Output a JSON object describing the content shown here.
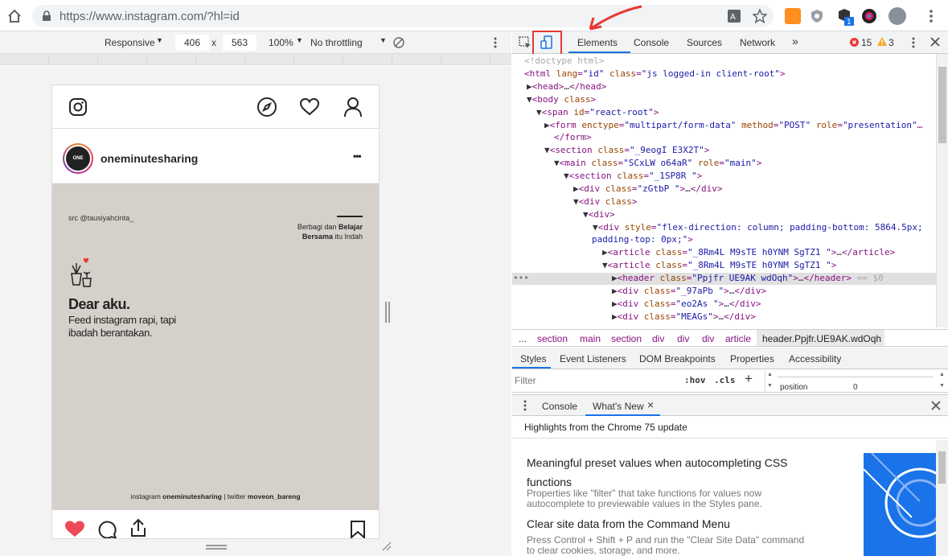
{
  "browser": {
    "url": "https://www.instagram.com/?hl=id"
  },
  "device_toolbar": {
    "mode": "Responsive",
    "width": "406",
    "times": "x",
    "height": "563",
    "zoom": "100%",
    "throttle": "No throttling"
  },
  "instagram": {
    "username": "oneminutesharing",
    "more": "•••",
    "avatar_text": "ONE",
    "post": {
      "src": "src @tausiyahcinta_",
      "tagline_line1": "Berbagi dan",
      "tagline_bold1": "Belajar",
      "tagline_bold2": "Bersama",
      "tagline_line2": "itu Indah",
      "title": "Dear aku.",
      "body_line1": "Feed instagram rapi, tapi",
      "body_line2": "ibadah berantakan.",
      "footer_prefix": "instagram",
      "footer_bold1": "oneminutesharing",
      "footer_mid": "| twitter",
      "footer_bold2": "moveon_bareng"
    }
  },
  "devtools": {
    "tabs": [
      "Elements",
      "Console",
      "Sources",
      "Network"
    ],
    "more_tabs": "»",
    "errors": "15",
    "warnings": "3",
    "breadcrumbs": [
      "...",
      "section",
      "main",
      "section",
      "div",
      "div",
      "div",
      "article",
      "header.Ppjfr.UE9AK.wdOqh"
    ],
    "styles_tabs": [
      "Styles",
      "Event Listeners",
      "DOM Breakpoints",
      "Properties",
      "Accessibility"
    ],
    "filter_placeholder": "Filter",
    "hov": ":hov",
    "cls": ".cls",
    "plus": "+",
    "computed_prop": "position",
    "computed_val": "0",
    "drawer_tabs": [
      "Console",
      "What's New"
    ],
    "drawer_close_tab": "×",
    "drawer_headline": "Highlights from the Chrome 75 update",
    "news": [
      {
        "title": "Meaningful preset values when autocompleting CSS",
        "title2": "functions",
        "desc": "Properties like \"filter\" that take functions for values now",
        "desc2": "autocomplete to previewable values in the Styles pane."
      },
      {
        "title": "Clear site data from the Command Menu",
        "desc": "Press Control + Shift + P and run the \"Clear Site Data\" command",
        "desc2": "to clear cookies, storage, and more."
      }
    ],
    "dom": {
      "l1": "<!doctype html>",
      "eq": "== $0"
    }
  },
  "colors": {
    "accent": "#1a73e8",
    "highlight": "#e53935",
    "dom_tag": "#881280",
    "dom_attr": "#994500",
    "dom_value": "#1a1aa6"
  }
}
